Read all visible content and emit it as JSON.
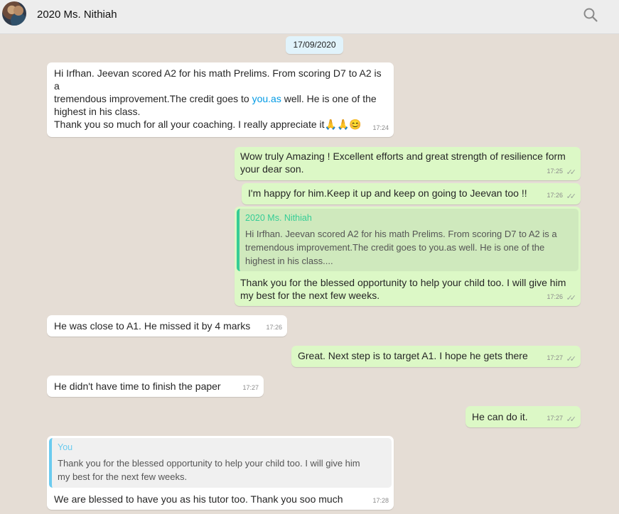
{
  "header": {
    "title": "2020 Ms. Nithiah",
    "search_icon": "search-icon"
  },
  "date_chip": "17/09/2020",
  "messages": [
    {
      "direction": "in",
      "text_a": "Hi Irfhan. Jeevan scored A2 for his math Prelims. From scoring D7 to A2 is a",
      "text_b": "tremendous improvement.The credit goes to ",
      "link": "you.as",
      "text_c": " well. He is one of the",
      "text_d": "highest in his class.",
      "text_e": "Thank you so much for all your coaching. I really appreciate it",
      "emoji": "🙏🙏😊",
      "time": "17:24"
    },
    {
      "direction": "out",
      "text_a": "Wow truly Amazing ! Excellent efforts and great strength of resilience form",
      "text_b": "your dear son.",
      "time": "17:25"
    },
    {
      "direction": "out",
      "text": "I'm happy for him.Keep it up and keep on going to Jeevan too !!",
      "time": "17:26"
    },
    {
      "direction": "out",
      "quote_name": "2020 Ms. Nithiah",
      "quote_a": "Hi Irfhan. Jeevan scored A2 for his math Prelims. From scoring D7 to A2 is a",
      "quote_b": "tremendous improvement.The credit goes to you.as well. He is one of the",
      "quote_c": "highest in his class....",
      "text_a": "Thank you for the blessed opportunity  to help your child too. I will give him",
      "text_b": "my best for the next few weeks.",
      "time": "17:26"
    },
    {
      "direction": "in",
      "text": "He was close to A1. He missed it by 4 marks",
      "time": "17:26"
    },
    {
      "direction": "out",
      "text": "Great. Next step is to target A1. I hope he gets there",
      "time": "17:27"
    },
    {
      "direction": "in",
      "text": "He didn't have time to finish the paper",
      "time": "17:27"
    },
    {
      "direction": "out",
      "text": "He can do it.",
      "time": "17:27"
    },
    {
      "direction": "in",
      "quote_name": "You",
      "quote_a": "Thank you for the blessed opportunity  to help your child too. I will give him",
      "quote_b": "my best for the next few weeks.",
      "text": "We are blessed to have you as his tutor too. Thank you soo much",
      "time": "17:28"
    }
  ],
  "ticks": "✓✓",
  "colors": {
    "background": "#e5ddd5",
    "header": "#ededed",
    "incoming": "#ffffff",
    "outgoing": "#dcf8c6",
    "link": "#039be5",
    "quote_out_bar": "#35cd96",
    "quote_in_bar": "#6bcbef"
  }
}
